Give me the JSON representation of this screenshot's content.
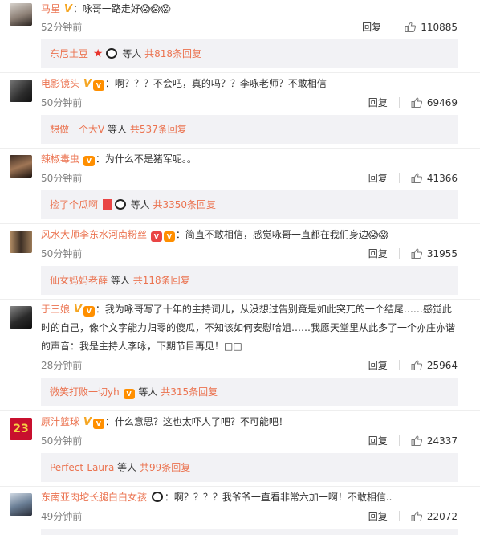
{
  "comments": [
    {
      "user": "马星",
      "sep": "：",
      "text": "咏哥一路走好😱😱😱",
      "time": "52分钟前",
      "reply": "回复",
      "likes": "110885",
      "sub": {
        "user": "东尼土豆",
        "mid": "等人",
        "total": "共818条回复"
      }
    },
    {
      "user": "电影镜头",
      "sep": "：",
      "text": "啊？？？不会吧，真的吗？？李咏老师？不敢相信",
      "time": "50分钟前",
      "reply": "回复",
      "likes": "69469",
      "sub": {
        "user": "想做一个大V",
        "mid": "等人",
        "total": "共537条回复"
      }
    },
    {
      "user": "辣椒毒虫",
      "sep": "：",
      "text": "为什么不是猪军呢。。",
      "time": "50分钟前",
      "reply": "回复",
      "likes": "41366",
      "sub": {
        "user": "捡了个瓜啊",
        "mid": "等人",
        "total": "共3350条回复"
      }
    },
    {
      "user": "风水大师李东水河南粉丝",
      "sep": "：",
      "text": "简直不敢相信，感觉咏哥一直都在我们身边😱😱",
      "time": "50分钟前",
      "reply": "回复",
      "likes": "31955",
      "sub": {
        "user": "仙女妈妈老薛",
        "mid": "等人",
        "total": "共118条回复"
      }
    },
    {
      "user": "于三娘",
      "sep": "：",
      "text1": "我为咏哥写了十年的主持词儿，从没想过告别竟是如此突兀的一个结尾……感觉此",
      "text2": "时的自己，像个文字能力归零的傻瓜，不知该如何安慰哈姐……我愿天堂里从此多了一个亦庄亦谐",
      "text3": "的声音：我是主持人李咏，下期节目再见！□□",
      "time": "28分钟前",
      "reply": "回复",
      "likes": "25964",
      "sub": {
        "user": "微笑打败一切yh",
        "mid": "等人",
        "total": "共315条回复"
      }
    },
    {
      "user": "原汁篮球",
      "sep": "：",
      "text": "什么意思？这也太吓人了吧？不可能吧！",
      "time": "50分钟前",
      "reply": "回复",
      "likes": "24337",
      "sub": {
        "user": "Perfect-Laura",
        "mid": "等人",
        "total": "共99条回复"
      }
    },
    {
      "user": "东南亚肉坨长腿白白女孩",
      "sep": "：",
      "text": "啊？？？？我爷爷一直看非常六加一啊！不敢相信..",
      "time": "49分钟前",
      "reply": "回复",
      "likes": "22072"
    }
  ],
  "colors": {
    "username": "#eb7350",
    "meta": "#808080",
    "subbox": "#f2f2f5"
  },
  "icons": {
    "like": "thumbs-up-icon",
    "verified": "v-badge-icon",
    "vip": "vip-crown-icon"
  }
}
